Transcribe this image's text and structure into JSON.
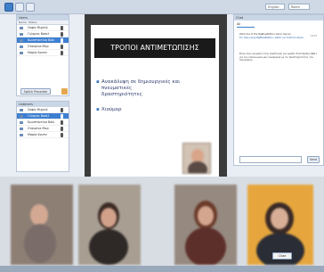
{
  "toolbar": {
    "language": "English",
    "room": "Room"
  },
  "users_panel": {
    "title": "Users",
    "columns": [
      "Name",
      "Status"
    ],
    "items": [
      {
        "name": "Σοφία Μιχαηλ"
      },
      {
        "name": "Γιώργος Βασιλ"
      },
      {
        "name": "Κωνσταντίνα Βοϊκ"
      },
      {
        "name": "Σταυρίνα Μαρ"
      },
      {
        "name": "Μαρία Κουτσ"
      }
    ],
    "button": "Switch Presenter"
  },
  "listeners_panel": {
    "title": "Listeners",
    "items": [
      {
        "name": "Σοφία Μιχαηλ"
      },
      {
        "name": "Γιώργος Βασιλ"
      },
      {
        "name": "Κωνσταντίνα Βοϊκ"
      },
      {
        "name": "Σταυρίνα Μαρ"
      },
      {
        "name": "Μαρία Κουτσ"
      }
    ]
  },
  "presentation": {
    "title": "ΤΡΟΠΟΙ ΑΝΤΙΜΕΤΩΠΙΣΗΣ",
    "bullets": [
      "Ανακάλυψη σε δημιουργικές και πνευματικές",
      "δραστηριότητες",
      "Χιούμορ"
    ],
    "page": "1/15"
  },
  "chat": {
    "title": "Chat",
    "tab": "All",
    "welcome": "Welcome to the BigBlueButton Demo Server.",
    "help": "For help using BigBlueButton, watch our tutorial videos.",
    "message": "Είναι ένας εργαλείο στην περίπτωση για ομάδα Υποστήριξης και για την επικοινωνία μας αναφορικά με τις δραστηριότητες του σεμιναρίου.",
    "time1": "16:07",
    "time2": "16:12",
    "send": "Send"
  },
  "video": {
    "close": "Close"
  },
  "colors": {
    "accent": "#3d7fd1",
    "header": "#c9d6e6",
    "slide_head": "#1a1a1a"
  }
}
